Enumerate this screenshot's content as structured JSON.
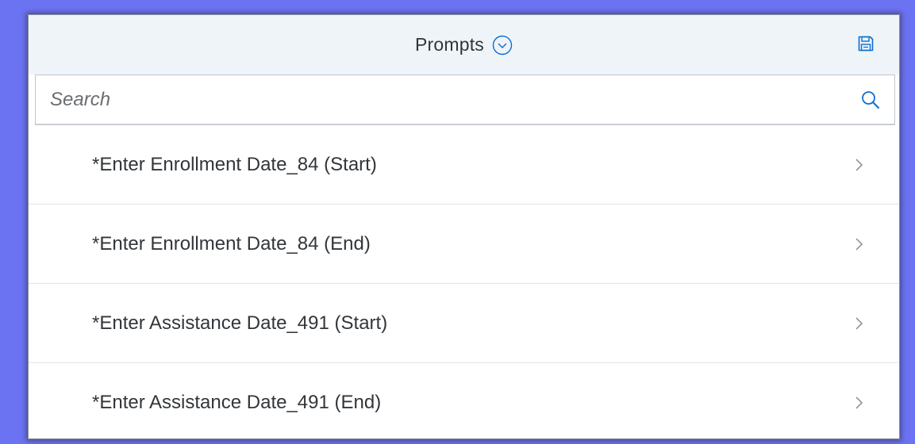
{
  "header": {
    "title": "Prompts",
    "toggle_icon": "chevron-down-circle-icon",
    "save_icon": "save-icon"
  },
  "search": {
    "placeholder": "Search",
    "value": "",
    "icon": "search-icon"
  },
  "prompts": [
    {
      "label": "*Enter Enrollment Date_84 (Start)"
    },
    {
      "label": "*Enter Enrollment Date_84 (End)"
    },
    {
      "label": "*Enter Assistance Date_491 (Start)"
    },
    {
      "label": "*Enter Assistance Date_491 (End)"
    }
  ],
  "colors": {
    "background": "#6b73f2",
    "header_bg": "#eff4f9",
    "text": "#32363a",
    "icon": "#0a6ed1",
    "chevron": "#8c8c8c"
  }
}
